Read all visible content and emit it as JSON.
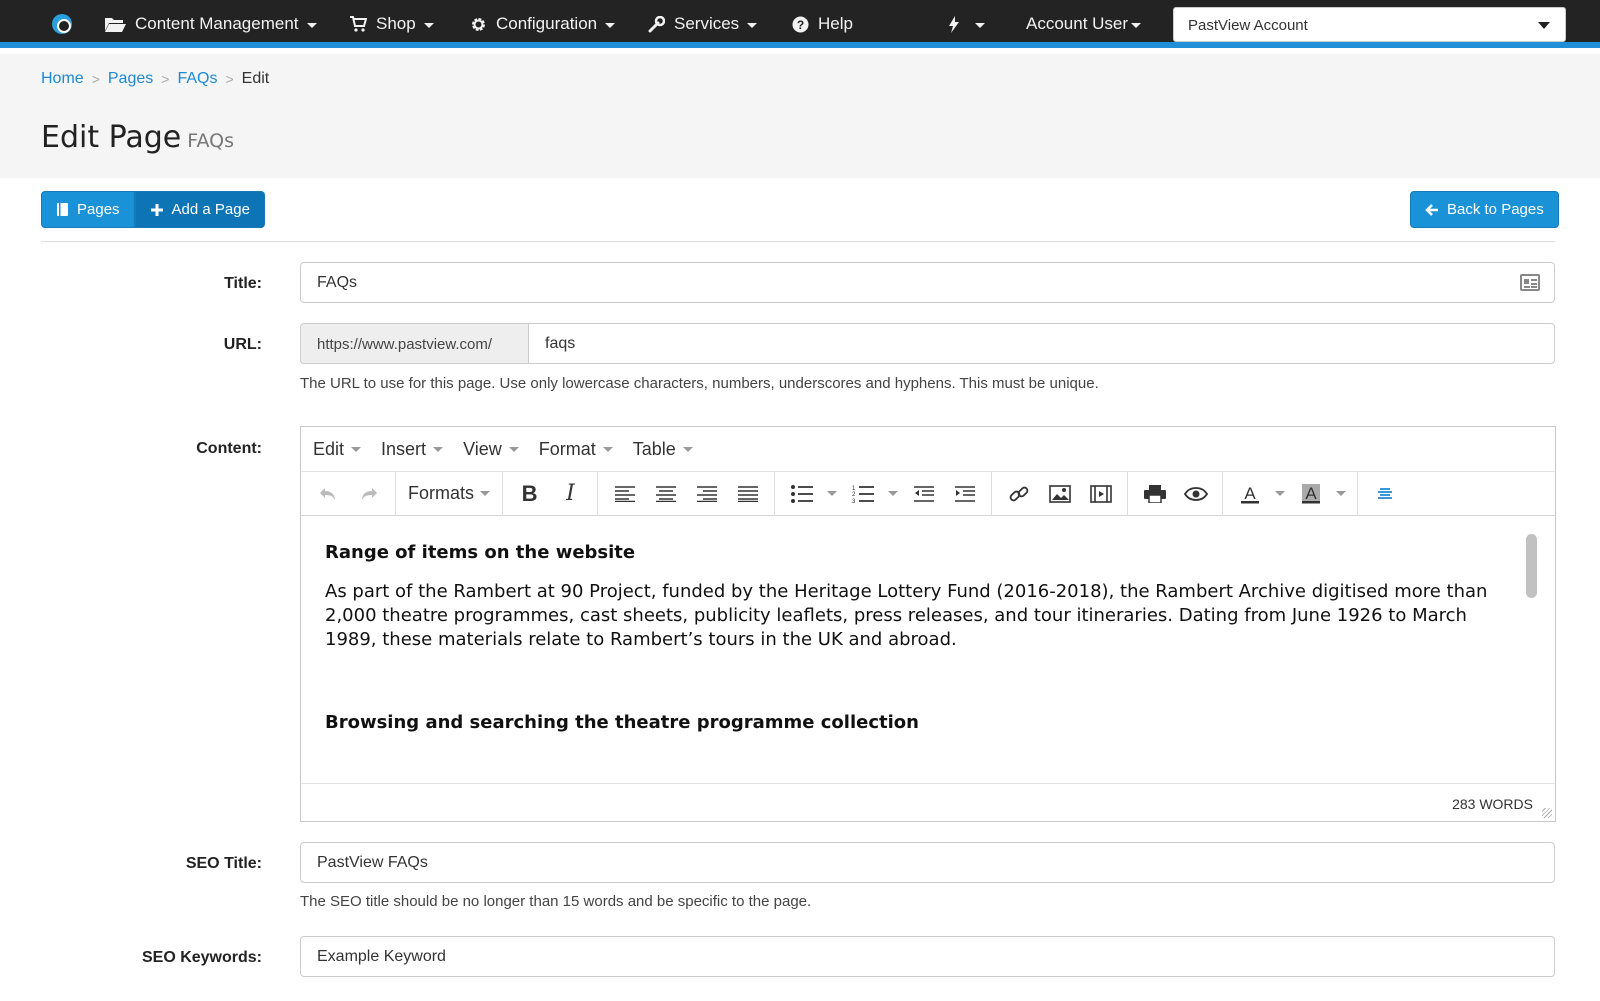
{
  "nav": {
    "content_management": "Content Management",
    "shop": "Shop",
    "configuration": "Configuration",
    "services": "Services",
    "help": "Help",
    "account_user": "Account User",
    "account_select": "PastView Account"
  },
  "breadcrumb": {
    "home": "Home",
    "pages": "Pages",
    "faqs": "FAQs",
    "current": "Edit"
  },
  "page": {
    "title": "Edit Page",
    "subtitle": "FAQs"
  },
  "buttons": {
    "pages": "Pages",
    "add_page": "Add a Page",
    "back": "Back to Pages"
  },
  "form": {
    "title_label": "Title:",
    "title_value": "FAQs",
    "url_label": "URL:",
    "url_prefix": "https://www.pastview.com/",
    "url_value": "faqs",
    "url_help": "The URL to use for this page. Use only lowercase characters, numbers, underscores and hyphens. This must be unique.",
    "content_label": "Content:",
    "seo_title_label": "SEO Title:",
    "seo_title_value": "PastView FAQs",
    "seo_title_help": "The SEO title should be no longer than 15 words and be specific to the page.",
    "seo_keywords_label": "SEO Keywords:",
    "seo_keywords_value": "Example Keyword"
  },
  "editor": {
    "menu": [
      "Edit",
      "Insert",
      "View",
      "Format",
      "Table"
    ],
    "formats_label": "Formats",
    "heading1": "Range of items on the website",
    "paragraph1": "As part of the Rambert at 90 Project, funded by the Heritage Lottery Fund (2016-2018), the Rambert Archive digitised more than 2,000 theatre programmes, cast sheets, publicity leaflets, press releases, and tour itineraries. Dating from June 1926 to March 1989, these materials relate to Rambert’s tours in the UK and abroad.",
    "heading2": "Browsing and searching the theatre programme collection",
    "word_count": "283 WORDS"
  },
  "colors": {
    "nav_bg": "#232323",
    "accent": "#1f8fd8",
    "button": "#1992d8",
    "link": "#1e88d0"
  }
}
